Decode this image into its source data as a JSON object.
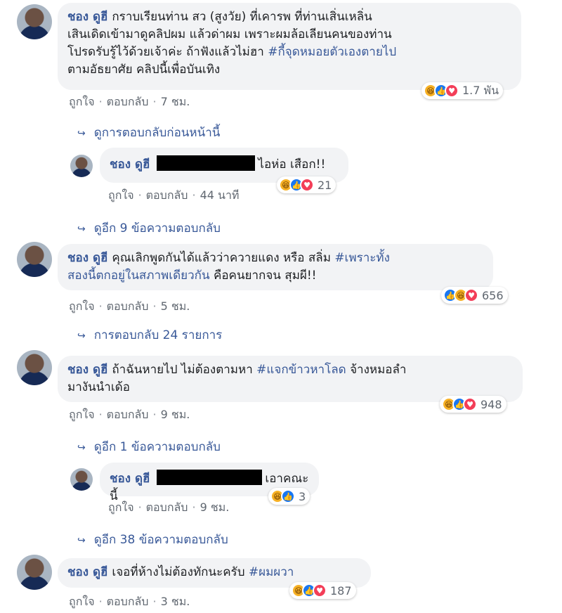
{
  "user_name": "ชอง ดูฮี",
  "labels": {
    "like": "ถูกใจ",
    "reply": "ตอบกลับ",
    "sep": "·"
  },
  "c1": {
    "text_a": "กราบเรียนท่าน สว (สูงวัย) ที่เคารพ ที่ท่านเสิ่นเหลิ่น",
    "text_b": "เสินเดิดเข้ามาดูคลิปผม แล้วด่าผม เพราะผมล้อเลียนคนของท่าน",
    "text_c": "โปรดรับรู้ไว้ด้วยเจ้าค่ะ ถ้าฟังแล้วไม่ฮา ",
    "hashtag": "#กี้จุดหมอยตัวเองตายไป",
    "text_d": "ตามอัธยาศัย คลิปนี้เพื่อบันเทิง",
    "time": "7 ชม.",
    "reactions": "1.7 พัน",
    "prev_link": "ดูการตอบกลับก่อนหน้านี้"
  },
  "r1": {
    "text": "ไอห่อ เสือก!!",
    "time": "44 นาที",
    "reactions": "21",
    "more_link": "ดูอีก 9 ข้อความตอบกลับ"
  },
  "c2": {
    "text_a": "คุณเลิกพูดกันได้แล้วว่าควายแดง หรือ สลิ่ม ",
    "hashtag_a": "#เพราะทั้ง",
    "hashtag_b": "สองนี้ตกอยู่ในสภาพเดียวกัน",
    "text_b": " คือคนยากจน สุมผี!!",
    "time": "5 ชม.",
    "reactions": "656",
    "replies_link": "การตอบกลับ 24 รายการ"
  },
  "c3": {
    "text_a": "ถ้าฉันหายไป ไม่ต้องตามหา ",
    "hashtag": "#แจกข้าวหาโลด",
    "text_b": " จ้างหมอลำ",
    "text_c": "มางันนำเด้อ",
    "time": "9 ชม.",
    "reactions": "948",
    "more_link": "ดูอีก 1 ข้อความตอบกลับ"
  },
  "r2": {
    "text": "เอาคณะนี้",
    "time": "9 ชม.",
    "reactions": "3",
    "more_link": "ดูอีก 38 ข้อความตอบกลับ"
  },
  "c4": {
    "text_a": "เจอที่ห้างไม่ต้องทักนะครับ ",
    "hashtag": "#ผมผวา",
    "time": "3 ชม.",
    "reactions": "187"
  },
  "colors": {
    "link": "#385898",
    "bubble": "#f2f3f5",
    "meta": "#606770",
    "haha": "#f7b125",
    "like": "#1877f2",
    "love": "#f33e58"
  },
  "icons": {
    "reply_arrow": "reply-arrow-icon",
    "haha": "haha-reaction-icon",
    "like": "like-reaction-icon",
    "love": "love-reaction-icon"
  }
}
